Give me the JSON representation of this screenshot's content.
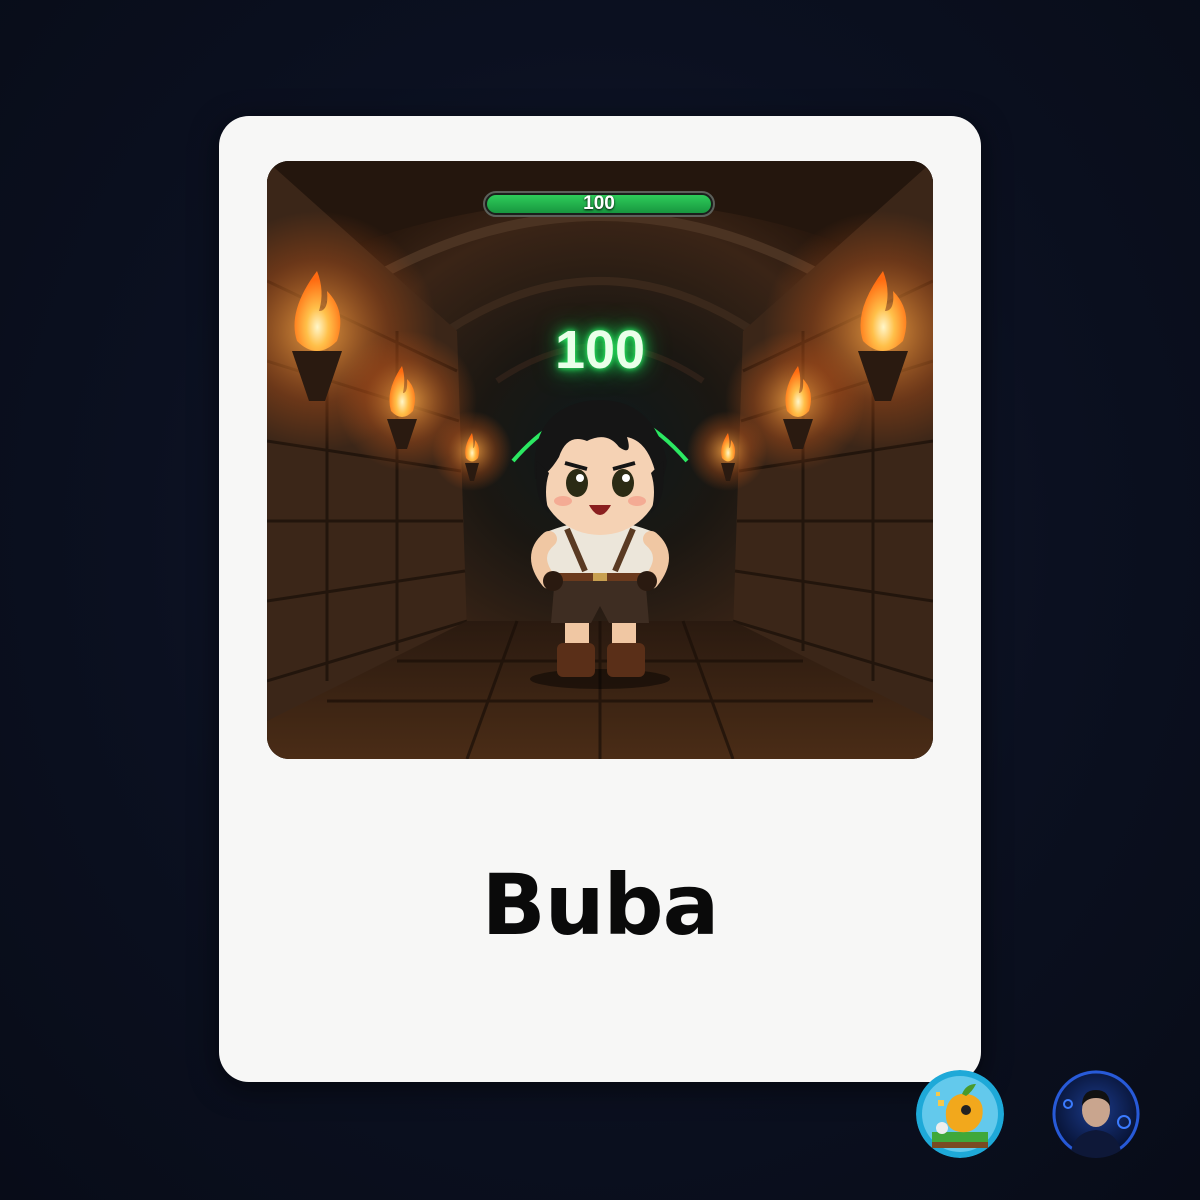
{
  "card": {
    "name": "Buba",
    "health_bar": {
      "value_label": "100",
      "fill_fraction": 1.0,
      "fill_color": "#2ecc5a"
    },
    "floating_value": "100",
    "scene": {
      "torches": 6,
      "setting_colors": {
        "fire": "#ff9a2e",
        "stone": "#3a2a1e"
      }
    }
  },
  "badges": [
    {
      "icon": "game-logo-icon",
      "ring_color": "#1ea9d8"
    },
    {
      "icon": "user-avatar-icon",
      "glow_color": "#2f6bff"
    }
  ]
}
